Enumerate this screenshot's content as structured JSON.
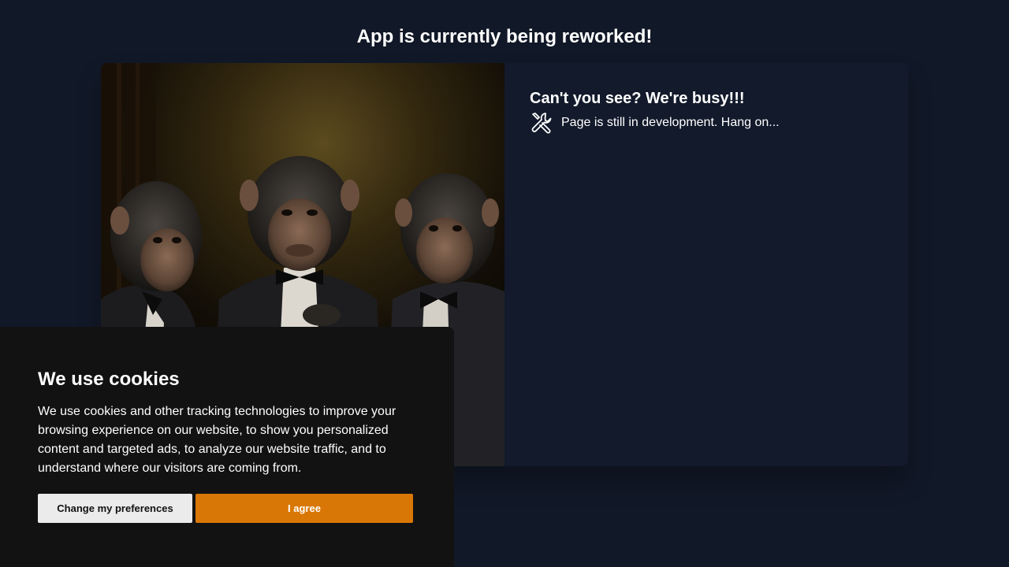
{
  "page": {
    "title": "App is currently being reworked!"
  },
  "card": {
    "image_alt": "Three chimpanzees wearing tuxedos and bow ties",
    "heading": "Can't you see? We're busy!!!",
    "icon": "tools-icon",
    "text": "Page is still in development. Hang on..."
  },
  "cookie_banner": {
    "title": "We use cookies",
    "text": "We use cookies and other tracking technologies to improve your browsing experience on our website, to show you personalized content and targeted ads, to analyze our website traffic, and to understand where our visitors are coming from.",
    "preferences_label": "Change my preferences",
    "agree_label": "I agree"
  },
  "colors": {
    "background": "#111827",
    "card": "#121a2b",
    "banner": "#121212",
    "accent": "#d97706",
    "secondary_button": "#ebebeb"
  }
}
